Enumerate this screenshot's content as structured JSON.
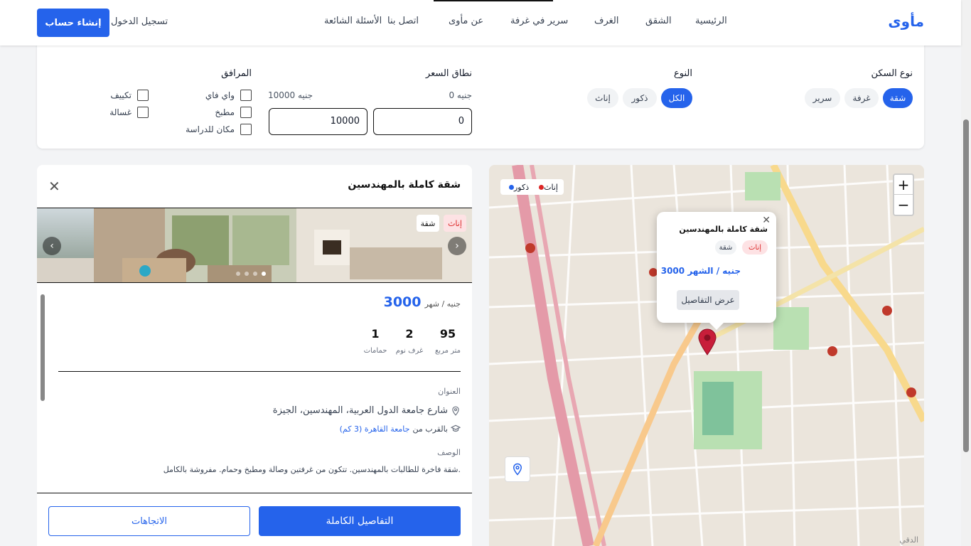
{
  "header": {
    "brand": "مأوى",
    "nav": [
      "الرئيسية",
      "الشقق",
      "الغرف",
      "سرير في غرفة",
      "عن مأوى",
      "اتصل بنا",
      "الأسئلة الشائعة"
    ],
    "login": "تسجيل الدخول",
    "signup": "إنشاء حساب"
  },
  "filters": {
    "housing_type": {
      "title": "نوع السكن",
      "options": [
        "شقة",
        "غرفة",
        "سرير"
      ],
      "selected": "شقة"
    },
    "gender": {
      "title": "النوع",
      "options": [
        "الكل",
        "ذكور",
        "إناث"
      ],
      "selected": "الكل"
    },
    "price": {
      "title": "نطاق السعر",
      "min_label": "0 جنيه",
      "max_label": "10000 جنيه",
      "min_value": "0",
      "max_value": "10000"
    },
    "amenities": {
      "title": "المرافق",
      "items": [
        "واي فاي",
        "تكييف",
        "مطبخ",
        "غسالة",
        "مكان للدراسة"
      ]
    }
  },
  "map": {
    "legend": {
      "male": "ذكور",
      "female": "إناث"
    },
    "zoom_in": "+",
    "zoom_out": "−",
    "attribution": "الدقي",
    "popup": {
      "title": "شقة كاملة بالمهندسين",
      "badge_gender": "إناث",
      "badge_type": "شقة",
      "price": "3000 جنيه / الشهر",
      "button": "عرض التفاصيل"
    }
  },
  "listing": {
    "title": "شقة كاملة بالمهندسين",
    "badge_gender": "إناث",
    "badge_type": "شقة",
    "price_value": "3000",
    "price_unit": "جنيه / شهر",
    "stats": [
      {
        "value": "95",
        "label": "متر مربع"
      },
      {
        "value": "2",
        "label": "غرف نوم"
      },
      {
        "value": "1",
        "label": "حمامات"
      }
    ],
    "address_label": "العنوان",
    "address": "شارع جامعة الدول العربية، المهندسين، الجيزة",
    "near_prefix": "بالقرب من",
    "near_place": "جامعة القاهرة (3 كم)",
    "description_label": "الوصف",
    "description": "شقة فاخرة للطالبات بالمهندسين. تتكون من غرفتين وصالة ومطبخ وحمام. مفروشة بالكامل.",
    "gallery_total": 4,
    "gallery_active": 1,
    "btn_full": "التفاصيل الكاملة",
    "btn_directions": "الاتجاهات"
  },
  "colors": {
    "accent": "#2563eb",
    "female": "#dc2626",
    "male": "#2563eb"
  }
}
